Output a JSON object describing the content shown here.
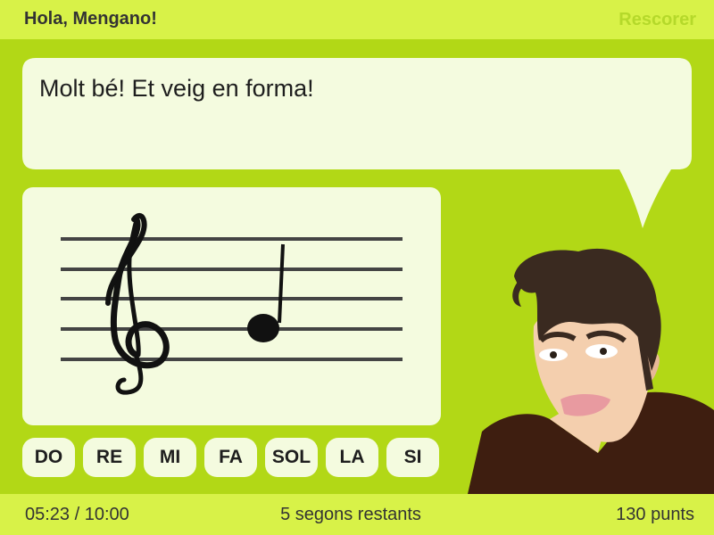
{
  "header": {
    "greeting": "Hola, Mengano!",
    "reset_label": "Rescorer"
  },
  "speech": {
    "text": "Molt bé! Et veig en forma!"
  },
  "staff": {
    "clef": "treble-clef-icon",
    "note": "quarter-note-icon"
  },
  "answers": [
    "DO",
    "RE",
    "MI",
    "FA",
    "SOL",
    "LA",
    "SI"
  ],
  "footer": {
    "timer": "05:23 / 10:00",
    "remaining": "5 segons restants",
    "score": "130 punts"
  },
  "colors": {
    "background": "#b2d816",
    "bar": "#d8f248",
    "panel": "#f4fbdf",
    "reset_link": "#b5d92a",
    "hair": "#3a2a20",
    "skin": "#f4cfae",
    "shirt": "#3e1e10"
  }
}
